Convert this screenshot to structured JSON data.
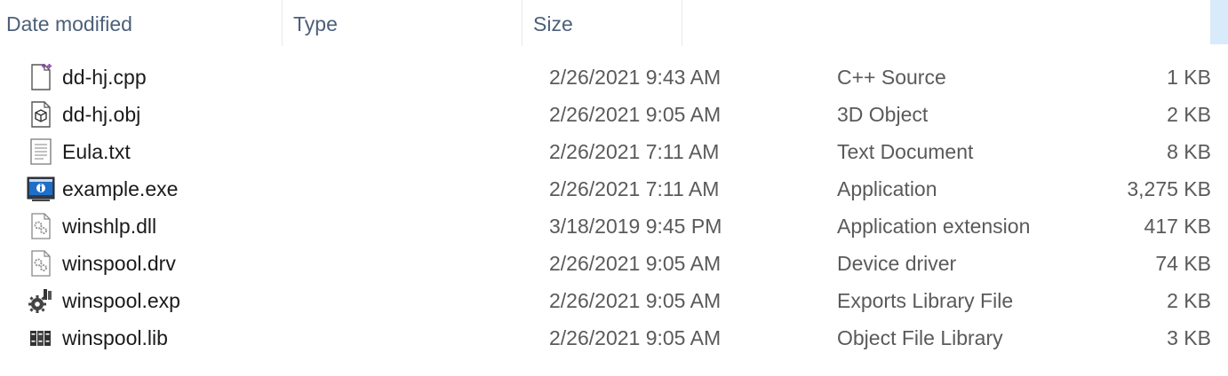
{
  "columns": {
    "date_modified": "Date modified",
    "type": "Type",
    "size": "Size"
  },
  "files": [
    {
      "name": "dd-hj.cpp",
      "date": "2/26/2021 9:43 AM",
      "type": "C++ Source",
      "size": "1 KB",
      "icon": "cpp-file-icon"
    },
    {
      "name": "dd-hj.obj",
      "date": "2/26/2021 9:05 AM",
      "type": "3D Object",
      "size": "2 KB",
      "icon": "3d-object-file-icon"
    },
    {
      "name": "Eula.txt",
      "date": "2/26/2021 7:11 AM",
      "type": "Text Document",
      "size": "8 KB",
      "icon": "text-file-icon"
    },
    {
      "name": "example.exe",
      "date": "2/26/2021 7:11 AM",
      "type": "Application",
      "size": "3,275 KB",
      "icon": "application-icon"
    },
    {
      "name": "winshlp.dll",
      "date": "3/18/2019 9:45 PM",
      "type": "Application extension",
      "size": "417 KB",
      "icon": "dll-file-icon"
    },
    {
      "name": "winspool.drv",
      "date": "2/26/2021 9:05 AM",
      "type": "Device driver",
      "size": "74 KB",
      "icon": "driver-file-icon"
    },
    {
      "name": "winspool.exp",
      "date": "2/26/2021 9:05 AM",
      "type": "Exports Library File",
      "size": "2 KB",
      "icon": "exports-library-icon"
    },
    {
      "name": "winspool.lib",
      "date": "2/26/2021 9:05 AM",
      "type": "Object File Library",
      "size": "3 KB",
      "icon": "object-library-icon"
    }
  ],
  "colors": {
    "header_text": "#4c607a",
    "name_text": "#1b1b1b",
    "detail_text": "#5a5a5a",
    "scroll_thumb": "#d9ebfa"
  }
}
